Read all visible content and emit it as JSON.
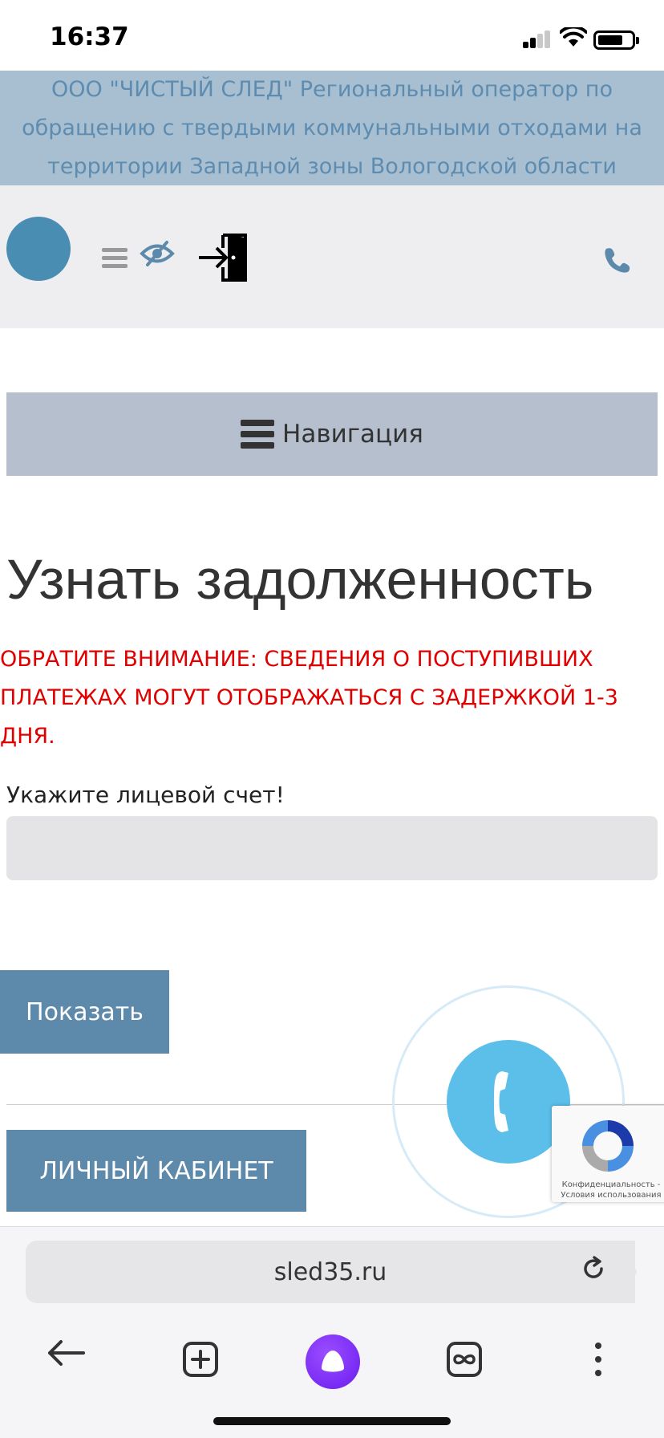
{
  "status_bar": {
    "time": "16:37"
  },
  "org_banner": {
    "text": "ООО \"ЧИСТЫЙ СЛЕД\" Региональный оператор по обращению с твердыми коммунальными отходами на территории Западной зоны Вологодской области"
  },
  "header": {
    "icons": [
      "menu-icon",
      "eye-crossed-icon",
      "login-door-icon",
      "phone-icon"
    ]
  },
  "navigation": {
    "label": "Навигация"
  },
  "page": {
    "title": "Узнать задолженность",
    "notice": "ОБРАТИТЕ ВНИМАНИЕ: СВЕДЕНИЯ О ПОСТУПИВШИХ ПЛАТЕЖАХ МОГУТ ОТОБРАЖАТЬСЯ С ЗАДЕРЖКОЙ 1-3 ДНЯ.",
    "account_label": "Укажите лицевой счет!",
    "account_value": "",
    "show_button": "Показать",
    "cabinet_button": "ЛИЧНЫЙ КАБИНЕТ"
  },
  "recaptcha": {
    "text": "Конфиденциальность - Условия использования"
  },
  "browser": {
    "url": "sled35.ru"
  },
  "colors": {
    "banner_bg": "#a7bfd0",
    "banner_text": "#5e8cb1",
    "button_bg": "#5d89aa",
    "notice_red": "#e00000",
    "call_fab": "#5bbfe9",
    "logo": "#4a8db3"
  }
}
